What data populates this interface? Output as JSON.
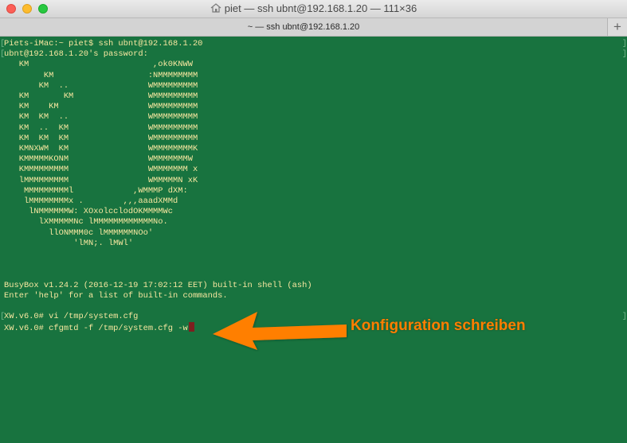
{
  "window": {
    "title": "piet — ssh ubnt@192.168.1.20 — 111×36",
    "tab_label": "~ — ssh ubnt@192.168.1.20",
    "add_tab_label": "+",
    "home_icon": "home-icon"
  },
  "terminal": {
    "lines": [
      "Piets-iMac:~ piet$ ssh ubnt@192.168.1.20",
      "ubnt@192.168.1.20's password:",
      "   KM                         ,ok0KNWW",
      "        KM                   :NMMMMMMMM",
      "       KM  ..                WMMMMMMMMM",
      "   KM       KM               WMMMMMMMMM",
      "   KM    KM                  WMMMMMMMMM",
      "   KM  KM  ..                WMMMMMMMMM",
      "   KM  ..  KM                WMMMMMMMMM",
      "   KM  KM  KM                WMMMMMMMMM",
      "   KMNXWM  KM                WMMMMMMMMK",
      "   KMMMMMKONM                WMMMMMMMW",
      "   KMMMMMMMMM                WMMMMMMM x",
      "   lMMMMMMMMM                WMMMMMN xK",
      "    MMMMMMMMMl            ,WMMMP dXM:",
      "    lMMMMMMMMx .        ,,,aaadXMMd",
      "     lNMMMMMMW: XOxolcclodOKMMMMWc",
      "       lXMMMMMNc lMMMMMMMMMMMMNo.",
      "         llONMMM0c lMMMMMMNOo'",
      "              'lMN;. lMWl'",
      "",
      "",
      "",
      "BusyBox v1.24.2 (2016-12-19 17:02:12 EET) built-in shell (ash)",
      "Enter 'help' for a list of built-in commands.",
      "",
      "XW.v6.0# vi /tmp/system.cfg",
      "XW.v6.0# cfgmtd -f /tmp/system.cfg -w"
    ]
  },
  "annotation": {
    "text": "Konfiguration schreiben",
    "color": "#ff7f00"
  },
  "colors": {
    "terminal_background": "#18733f",
    "terminal_text": "#f7e7a0",
    "cursor": "#7d1f1f"
  }
}
